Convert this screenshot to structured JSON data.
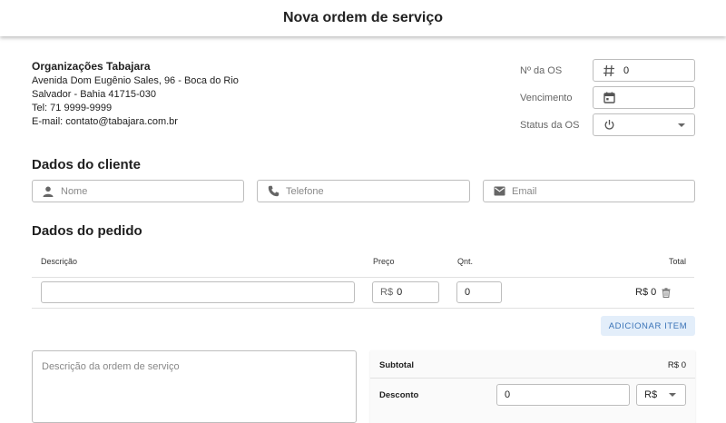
{
  "header": {
    "title": "Nova ordem de serviço"
  },
  "company": {
    "name": "Organizações Tabajara",
    "address_line1": "Avenida Dom Eugênio Sales, 96 - Boca do Rio",
    "address_line2": "Salvador - Bahia 41715-030",
    "phone": "Tel: 71 9999-9999",
    "email": "E-mail: contato@tabajara.com.br"
  },
  "order_meta": {
    "number_label": "Nº da OS",
    "number_value": "0",
    "due_label": "Vencimento",
    "due_value": "",
    "status_label": "Status da OS",
    "status_value": ""
  },
  "client": {
    "title": "Dados do cliente",
    "name_placeholder": "Nome",
    "phone_placeholder": "Telefone",
    "email_placeholder": "Email"
  },
  "order": {
    "title": "Dados do pedido",
    "columns": {
      "description": "Descrição",
      "price": "Preço",
      "qty": "Qnt.",
      "total": "Total"
    },
    "items": [
      {
        "description": "",
        "currency": "R$",
        "price": "0",
        "qty": "0",
        "total": "R$ 0"
      }
    ],
    "add_item_label": "Adicionar item"
  },
  "notes": {
    "placeholder": "Descrição da ordem de serviço"
  },
  "summary": {
    "subtotal_label": "Subtotal",
    "subtotal_value": "R$ 0",
    "discount_label": "Desconto",
    "discount_value": "0",
    "discount_unit": "R$"
  },
  "icons": {
    "number": "hash-icon",
    "due": "calendar-icon",
    "status": "power-icon",
    "name": "person-icon",
    "phone": "phone-icon",
    "email": "mail-icon",
    "delete": "trash-icon"
  }
}
